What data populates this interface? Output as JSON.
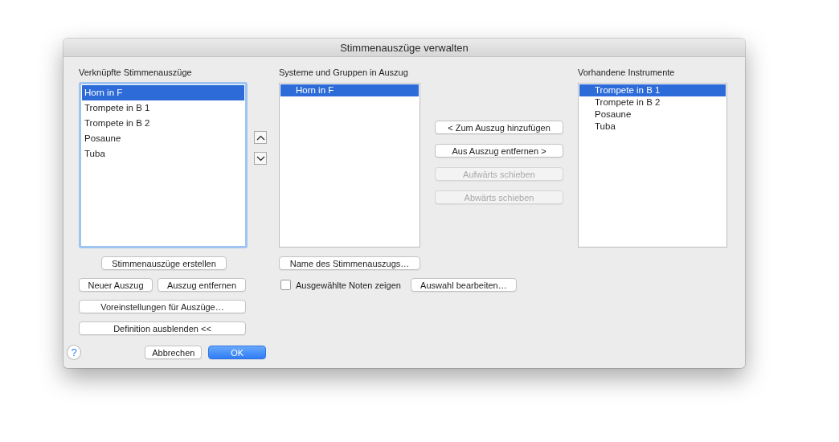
{
  "window": {
    "title": "Stimmenauszüge verwalten"
  },
  "linked_parts": {
    "label": "Verknüpfte Stimmenauszüge",
    "items": [
      {
        "label": "Horn in F",
        "selected": true
      },
      {
        "label": "Trompete in B 1",
        "selected": false
      },
      {
        "label": "Trompete in B 2",
        "selected": false
      },
      {
        "label": "Posaune",
        "selected": false
      },
      {
        "label": "Tuba",
        "selected": false
      }
    ]
  },
  "part_staves": {
    "label": "Systeme und Gruppen in Auszug",
    "items": [
      {
        "label": "Horn in F",
        "selected": true
      }
    ]
  },
  "transfer_buttons": [
    {
      "label": "< Zum Auszug hinzufügen",
      "disabled": false
    },
    {
      "label": "Aus Auszug entfernen >",
      "disabled": false
    },
    {
      "label": "Aufwärts schieben",
      "disabled": true
    },
    {
      "label": "Abwärts schieben",
      "disabled": true
    }
  ],
  "available_instruments": {
    "label": "Vorhandene Instrumente",
    "items": [
      {
        "label": "Trompete in B 1",
        "selected": true
      },
      {
        "label": "Trompete in B 2",
        "selected": false
      },
      {
        "label": "Posaune",
        "selected": false
      },
      {
        "label": "Tuba",
        "selected": false
      }
    ]
  },
  "create_parts_button": "Stimmenauszüge erstellen",
  "new_part_button": "Neuer Auszug",
  "remove_part_button": "Auszug entfernen",
  "part_settings_button": "Voreinstellungen für Auszüge…",
  "hide_definition_button": "Definition ausblenden <<",
  "part_name_button": "Name des Stimmenauszugs…",
  "show_selected_notes": {
    "label": "Ausgewählte Noten zeigen",
    "checked": false
  },
  "edit_selection_button": "Auswahl bearbeiten…",
  "help_button": "?",
  "cancel_button": "Abbrechen",
  "ok_button": "OK"
}
